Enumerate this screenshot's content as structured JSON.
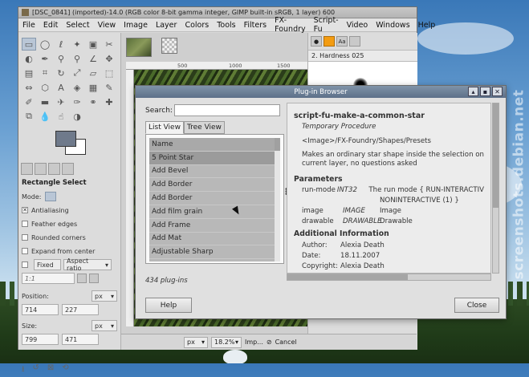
{
  "gimp": {
    "title": "[DSC_0841] (imported)-14.0 (RGB color 8-bit gamma integer, GIMP built-in sRGB, 1 layer) 600",
    "menu": [
      "File",
      "Edit",
      "Select",
      "View",
      "Image",
      "Layer",
      "Colors",
      "Tools",
      "Filters",
      "FX-Foundry",
      "Script-Fu",
      "Video",
      "Windows",
      "Help"
    ],
    "tool_options": {
      "title": "Rectangle Select",
      "mode_label": "Mode:",
      "antialiasing": "Antialiasing",
      "feather": "Feather edges",
      "rounded": "Rounded corners",
      "expand": "Expand from center",
      "fixed": "Fixed",
      "fixed_value": "Aspect ratio",
      "ratio": "1:1",
      "position_label": "Position:",
      "position_unit": "px",
      "position_x": "714",
      "position_y": "227",
      "size_label": "Size:",
      "size_unit": "px",
      "size_w": "799",
      "size_h": "471"
    },
    "ruler_ticks": [
      "500",
      "1000",
      "1500"
    ],
    "dock": {
      "brush_name": "2. Hardness 025",
      "tab_text": "Aa"
    },
    "status": {
      "unit": "px",
      "zoom": "18.2%",
      "message": "Imp...",
      "cancel": "Cancel"
    }
  },
  "dialog": {
    "title": "Plug-in Browser",
    "search_label": "Search:",
    "search_value": "",
    "tabs": [
      "List View",
      "Tree View"
    ],
    "list_header": "Name",
    "list_items": [
      "5 Point Star",
      "Add Bevel",
      "Add Border",
      "Add Border",
      "Add film grain",
      "Add Frame",
      "Add Mat",
      "Adjustable Sharp"
    ],
    "selected_index": 0,
    "count": "434 plug-ins",
    "info": {
      "procedure": "script-fu-make-a-common-star",
      "type": "Temporary Procedure",
      "menu_path": "<Image>/FX-Foundry/Shapes/Presets",
      "blurb": "Makes an ordinary star shape inside the selection on current layer, no questions asked",
      "params_title": "Parameters",
      "params": [
        {
          "name": "run-mode",
          "type": "INT32",
          "desc": "The run mode { RUN-INTERACTIV"
        },
        {
          "name": "",
          "type": "",
          "desc": "NONINTERACTIVE (1) }"
        },
        {
          "name": "image",
          "type": "IMAGE",
          "desc": "Image"
        },
        {
          "name": "drawable",
          "type": "DRAWABLE",
          "desc": "Drawable"
        }
      ],
      "additional_title": "Additional Information",
      "additional": [
        {
          "key": "Author:",
          "value": "Alexia Death"
        },
        {
          "key": "Date:",
          "value": "18.11.2007"
        },
        {
          "key": "Copyright:",
          "value": "Alexia Death"
        }
      ]
    },
    "help_label": "Help",
    "close_label": "Close"
  },
  "watermark": "screenshots.debian.net"
}
